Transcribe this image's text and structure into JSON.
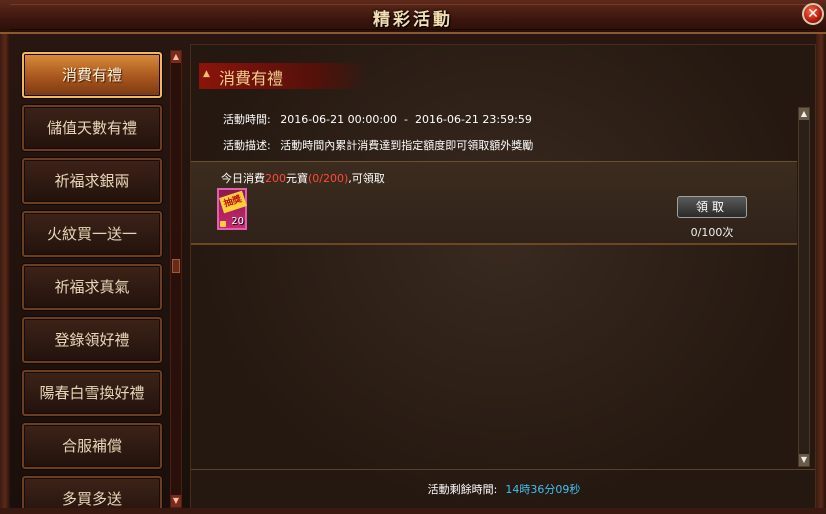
{
  "window": {
    "title": "精彩活動"
  },
  "sidebar": {
    "items": [
      {
        "label": "消費有禮",
        "active": true
      },
      {
        "label": "儲值天數有禮"
      },
      {
        "label": "祈福求銀兩"
      },
      {
        "label": "火紋買一送一"
      },
      {
        "label": "祈福求真氣"
      },
      {
        "label": "登錄領好禮"
      },
      {
        "label": "陽春白雪換好禮"
      },
      {
        "label": "合服補償"
      },
      {
        "label": "多買多送"
      }
    ]
  },
  "panel": {
    "title": "消費有禮",
    "time_label": "活動時間:",
    "time_value": "2016-06-21 00:00:00  -  2016-06-21 23:59:59",
    "desc_label": "活動描述:",
    "desc_value": "活動時間內累計消費達到指定額度即可領取額外獎勵",
    "tier": {
      "prefix": "今日消費",
      "amount": "200",
      "unit": "元寶",
      "progress": "(0/200)",
      "suffix": ",可領取",
      "item_label": "抽獎",
      "item_count": "20",
      "claim_label": "領取",
      "claim_count": "0/100次"
    }
  },
  "footer": {
    "label": "活動剩餘時間:",
    "remaining": "14時36分09秒"
  },
  "colors": {
    "active_tab": "#c87530",
    "highlight_red": "#ff4a3a",
    "highlight_green": "#3adf5a",
    "timer_blue": "#40c0f0"
  },
  "icons": {
    "close": "close-icon",
    "scroll_up": "arrow-up-icon",
    "scroll_down": "arrow-down-icon"
  }
}
